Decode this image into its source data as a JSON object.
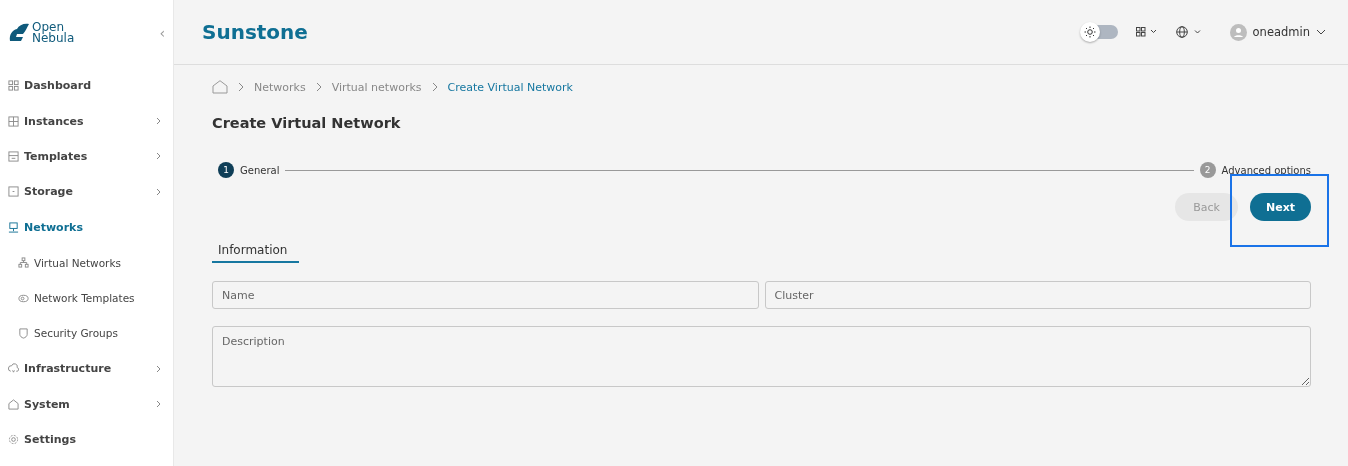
{
  "sidebar": {
    "logo": {
      "line1": "Open",
      "line2": "Nebula"
    },
    "collapse_glyph": "‹",
    "items": [
      {
        "label": "Dashboard",
        "expandable": false,
        "selected": false
      },
      {
        "label": "Instances",
        "expandable": true,
        "selected": false
      },
      {
        "label": "Templates",
        "expandable": true,
        "selected": false
      },
      {
        "label": "Storage",
        "expandable": true,
        "selected": false
      },
      {
        "label": "Networks",
        "expandable": false,
        "selected": true,
        "children": [
          {
            "label": "Virtual Networks",
            "selected": false
          },
          {
            "label": "Network Templates",
            "selected": false
          },
          {
            "label": "Security Groups",
            "selected": false
          }
        ]
      },
      {
        "label": "Infrastructure",
        "expandable": true,
        "selected": false
      },
      {
        "label": "System",
        "expandable": true,
        "selected": false
      },
      {
        "label": "Settings",
        "expandable": false,
        "selected": false
      }
    ]
  },
  "header": {
    "title": "Sunstone",
    "theme_toggle": {
      "on": false
    },
    "user": "oneadmin"
  },
  "breadcrumb": [
    {
      "label": "Networks",
      "selected": false
    },
    {
      "label": "Virtual networks",
      "selected": false
    },
    {
      "label": "Create Virtual Network",
      "selected": true
    }
  ],
  "page_title": "Create Virtual Network",
  "stepper": [
    {
      "number": "1",
      "label": "General",
      "selected": true
    },
    {
      "number": "2",
      "label": "Advanced options",
      "selected": false
    }
  ],
  "buttons": [
    {
      "label": "Back",
      "disabled": true,
      "highlighted": false
    },
    {
      "label": "Next",
      "disabled": false,
      "highlighted": true
    }
  ],
  "form_tabs": [
    {
      "label": "Information",
      "selected": true
    }
  ],
  "fields": [
    {
      "placeholder": "Name",
      "kind": "input"
    },
    {
      "placeholder": "Cluster",
      "kind": "input"
    },
    {
      "placeholder": "Description",
      "kind": "textarea"
    }
  ]
}
